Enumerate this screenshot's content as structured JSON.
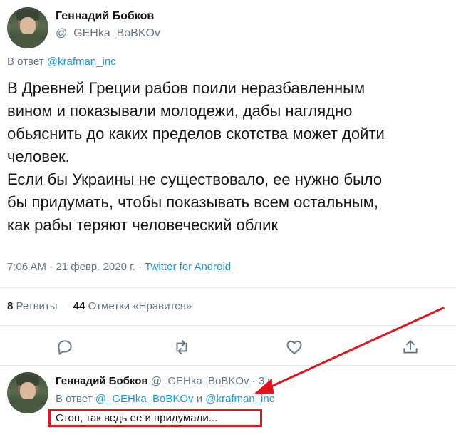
{
  "tweet": {
    "author_name": "Геннадий Бобков",
    "author_handle": "@_GEHka_BoBKOv",
    "reply_prefix": "В ответ",
    "reply_to": "@krafman_inc",
    "text": "В Древней Греции рабов поили неразбавленным\nвином и показывали молодежи, дабы наглядно\nобьяснить до каких пределов скотства может дойти\nчеловек.\nЕсли бы Украины не существовало, ее нужно было\nбы придумать, чтобы показывать всем остальным,\nкак рабы теряют человеческий облик",
    "time": "7:06 AM",
    "separator": "·",
    "date": "21 февр. 2020 г.",
    "source": "Twitter for Android",
    "retweets_count": "8",
    "retweets_label": "Ретвиты",
    "likes_count": "44",
    "likes_label": "Отметки «Нравится»"
  },
  "actions": [
    "reply-icon",
    "retweet-icon",
    "like-icon",
    "share-icon"
  ],
  "reply_tweet": {
    "author_name": "Геннадий Бобков",
    "author_handle": "@_GEHka_BoBKOv",
    "dot": "·",
    "age": "3 ч",
    "reply_prefix": "В ответ",
    "reply_to_1": "@_GEHka_BoBKOv",
    "reply_and": "и",
    "reply_to_2": "@krafman_inc",
    "text": "Стоп, так ведь ее и придумали..."
  },
  "colors": {
    "link": "#1b95e0",
    "muted": "#657786",
    "annotation": "#e3141b"
  }
}
